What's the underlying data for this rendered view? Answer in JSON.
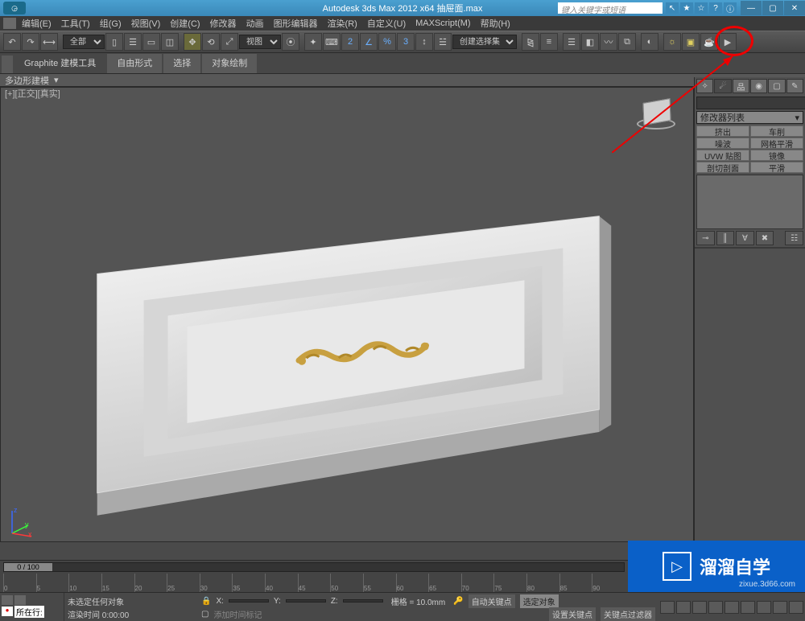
{
  "titlebar": {
    "app_title": "Autodesk 3ds Max  2012 x64     抽屉面.max",
    "search_placeholder": "键入关键字或短语",
    "toolicons": [
      "↖",
      "★",
      "☆",
      "?",
      "ⓘ"
    ]
  },
  "menubar": {
    "items": [
      "编辑(E)",
      "工具(T)",
      "组(G)",
      "视图(V)",
      "创建(C)",
      "修改器",
      "动画",
      "图形编辑器",
      "渲染(R)",
      "自定义(U)",
      "MAXScript(M)",
      "帮助(H)"
    ]
  },
  "toolbar": {
    "scope_label": "全部",
    "viewmode_label": "视图",
    "selection_set": "创建选择集"
  },
  "ribbon": {
    "tabs": [
      "Graphite 建模工具",
      "自由形式",
      "选择",
      "对象绘制"
    ],
    "sub": "多边形建模"
  },
  "viewport": {
    "label": "[+][正交][真实]"
  },
  "cmdpanel": {
    "modifier_list": "修改器列表",
    "buttons": [
      "挤出",
      "车削",
      "噪波",
      "网格平滑",
      "UVW 贴图",
      "镜像",
      "剖切剖面",
      "平滑"
    ]
  },
  "timeline": {
    "range": "0 / 100",
    "ticks": [
      "0",
      "5",
      "10",
      "15",
      "20",
      "25",
      "30",
      "35",
      "40",
      "45",
      "50",
      "55",
      "60",
      "65",
      "70",
      "75",
      "80",
      "85",
      "90"
    ]
  },
  "statusbar": {
    "row_label": "所在行:",
    "no_selection": "未选定任何对象",
    "render_time": "渲染时间  0:00:00",
    "x_label": "X:",
    "y_label": "Y:",
    "z_label": "Z:",
    "grid": "栅格 = 10.0mm",
    "autokey": "自动关键点",
    "selected": "选定对象",
    "setkey": "设置关键点",
    "keyfilter": "关键点过滤器",
    "add_time_tag": "添加时间标记"
  },
  "watermark": {
    "text": "溜溜自学",
    "url": "zixue.3d66.com"
  }
}
